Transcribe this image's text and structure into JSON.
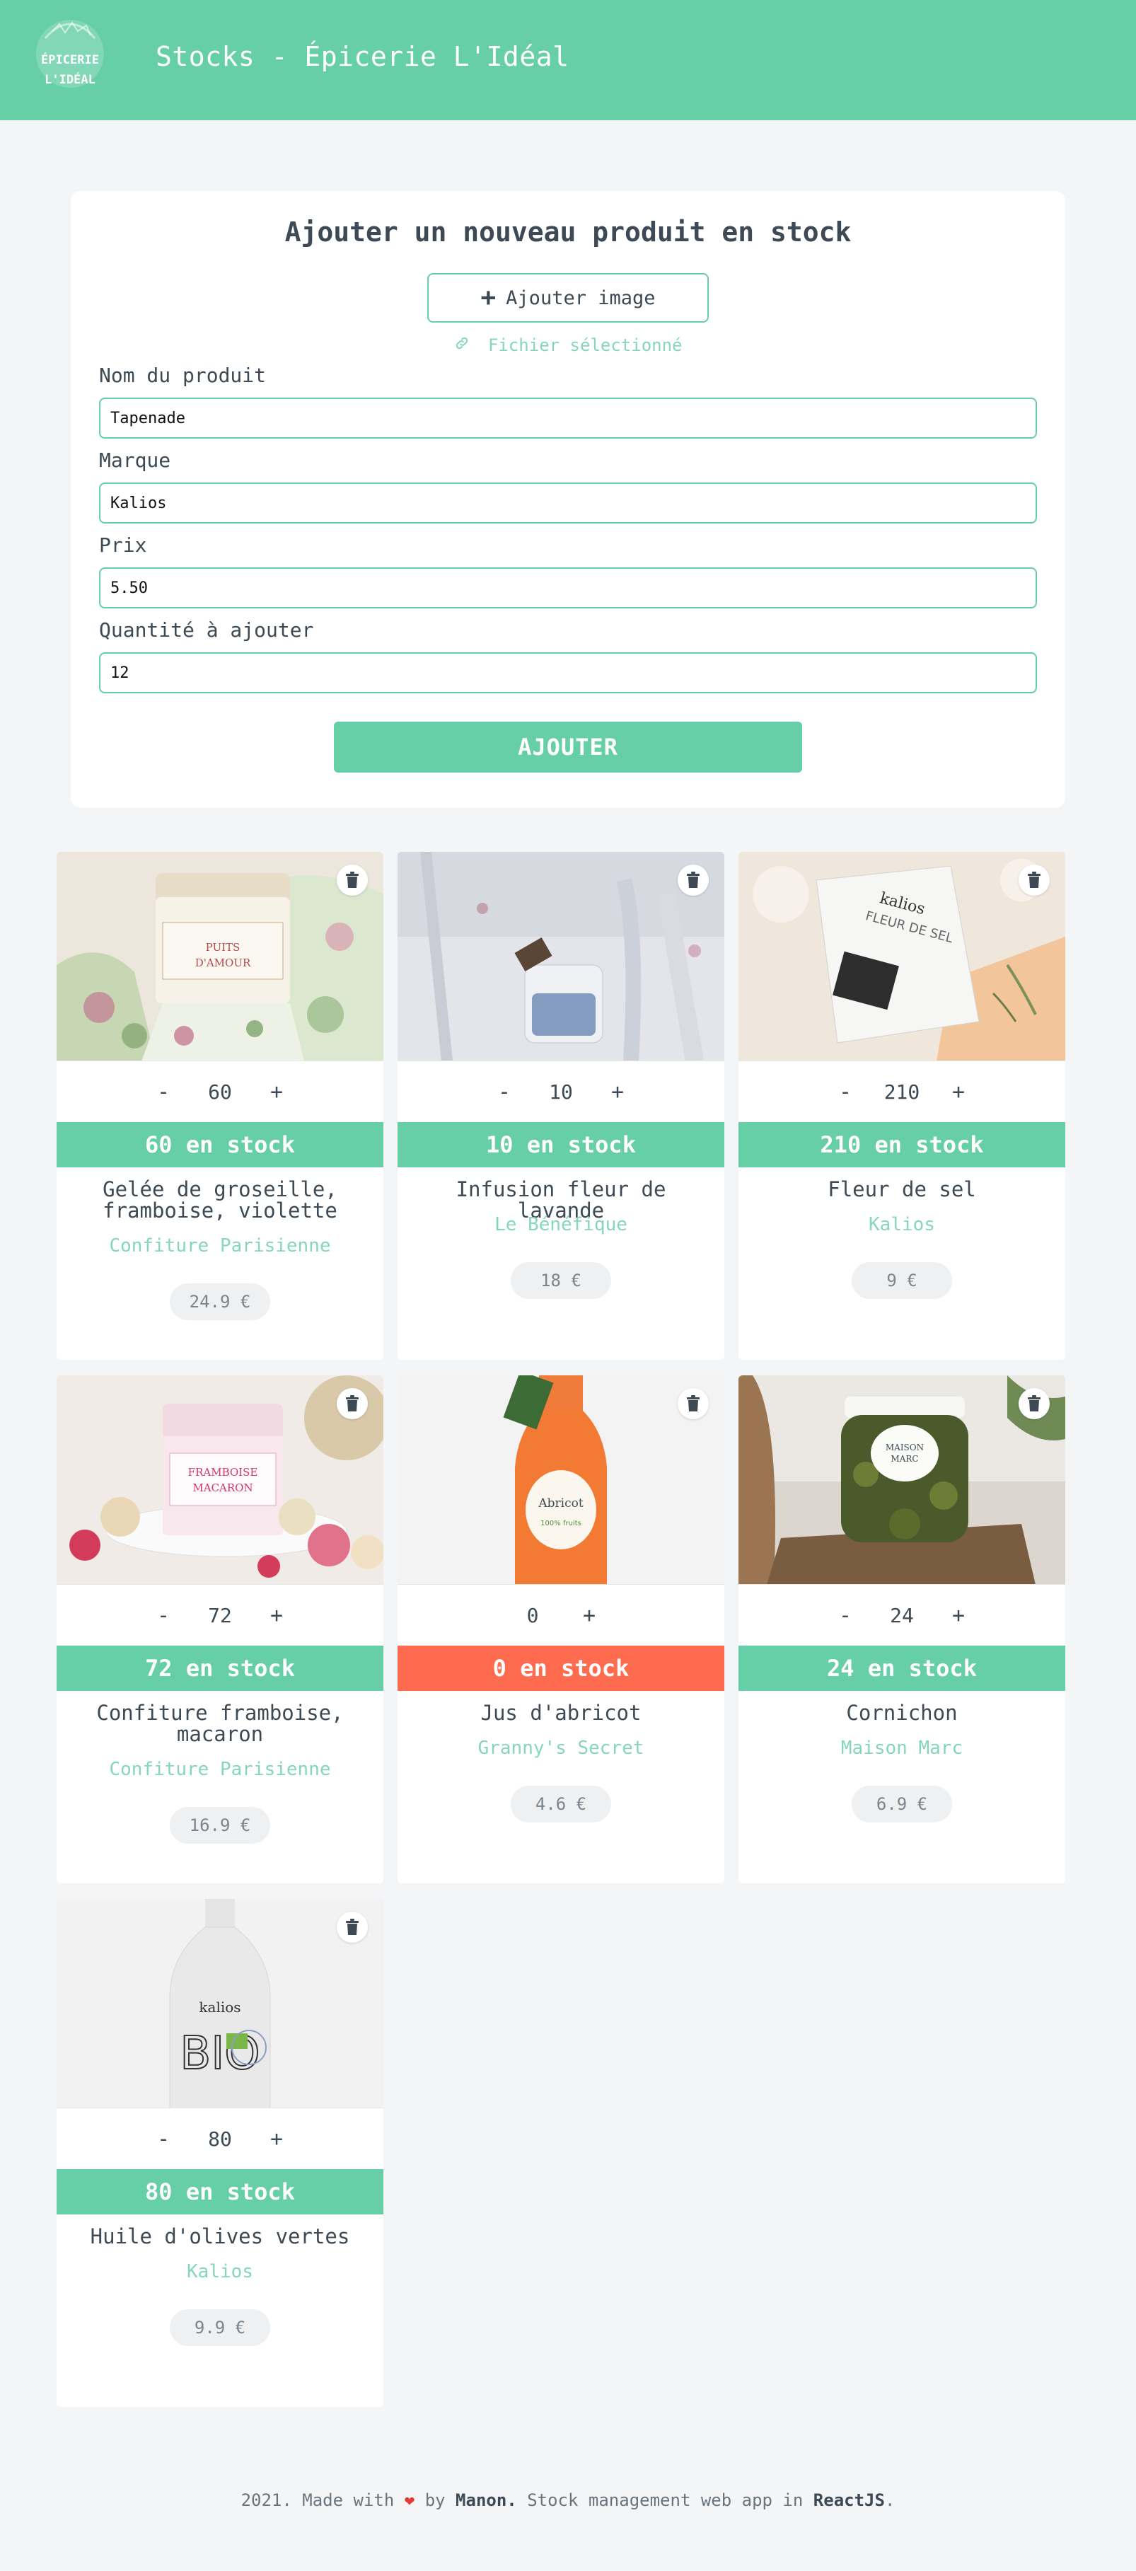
{
  "header": {
    "title": "Stocks - Épicerie L'Idéal",
    "logo_text": [
      "ÉPICERIE",
      "L'IDÉAL"
    ]
  },
  "form": {
    "title": "Ajouter un nouveau produit en stock",
    "add_image_label": "Ajouter image",
    "file_selected": "Fichier sélectionné",
    "fields": [
      {
        "label": "Nom du produit",
        "value": "Tapenade"
      },
      {
        "label": "Marque",
        "value": "Kalios"
      },
      {
        "label": "Prix",
        "value": "5.50"
      },
      {
        "label": "Quantité à ajouter",
        "value": "12"
      }
    ],
    "submit_label": "AJOUTER"
  },
  "products": [
    {
      "qty": "60",
      "stock_label": "60 en stock",
      "name": "Gelée de groseille, framboise, violette",
      "brand": "Confiture Parisienne",
      "price": "24.9 €",
      "in_stock": true
    },
    {
      "qty": "10",
      "stock_label": "10 en stock",
      "name": "Infusion fleur de lavande",
      "brand": "Le Bénéfique",
      "price": "18 €",
      "in_stock": true
    },
    {
      "qty": "210",
      "stock_label": "210 en stock",
      "name": "Fleur de sel",
      "brand": "Kalios",
      "price": "9 €",
      "in_stock": true
    },
    {
      "qty": "72",
      "stock_label": "72 en stock",
      "name": "Confiture framboise, macaron",
      "brand": "Confiture Parisienne",
      "price": "16.9 €",
      "in_stock": true
    },
    {
      "qty": "0",
      "stock_label": "0 en stock",
      "name": "Jus d'abricot",
      "brand": "Granny's Secret",
      "price": "4.6 €",
      "in_stock": false
    },
    {
      "qty": "24",
      "stock_label": "24 en stock",
      "name": "Cornichon",
      "brand": "Maison Marc",
      "price": "6.9 €",
      "in_stock": true
    },
    {
      "qty": "80",
      "stock_label": "80 en stock",
      "name": "Huile d'olives vertes",
      "brand": "Kalios",
      "price": "9.9 €",
      "in_stock": true
    }
  ],
  "product_images": {
    "p0": {
      "label_line1": "PUITS",
      "label_line2": "D'AMOUR"
    },
    "p2": {
      "label_line1": "kalios",
      "label_line2": "FLEUR DE SEL"
    },
    "p3": {
      "label_line1": "FRAMBOISE",
      "label_line2": "MACARON"
    },
    "p4": {
      "label_line1": "Abricot",
      "label_line2": "100% fruits"
    },
    "p5": {
      "label_line1": "MAISON",
      "label_line2": "MARC"
    },
    "p6": {
      "label_line1": "kalios",
      "label_line2": "BIO"
    }
  },
  "ui": {
    "minus": "-",
    "plus": "+"
  },
  "footer": {
    "prefix": "2021. Made with",
    "by": "by",
    "author": "Manon.",
    "middle": "Stock management web app in",
    "tech": "ReactJS",
    "suffix": "."
  },
  "colors": {
    "accent": "#66cfa8",
    "accent_light": "#86d7b9",
    "danger": "#ff6b4f",
    "background": "#f4f5f7"
  }
}
